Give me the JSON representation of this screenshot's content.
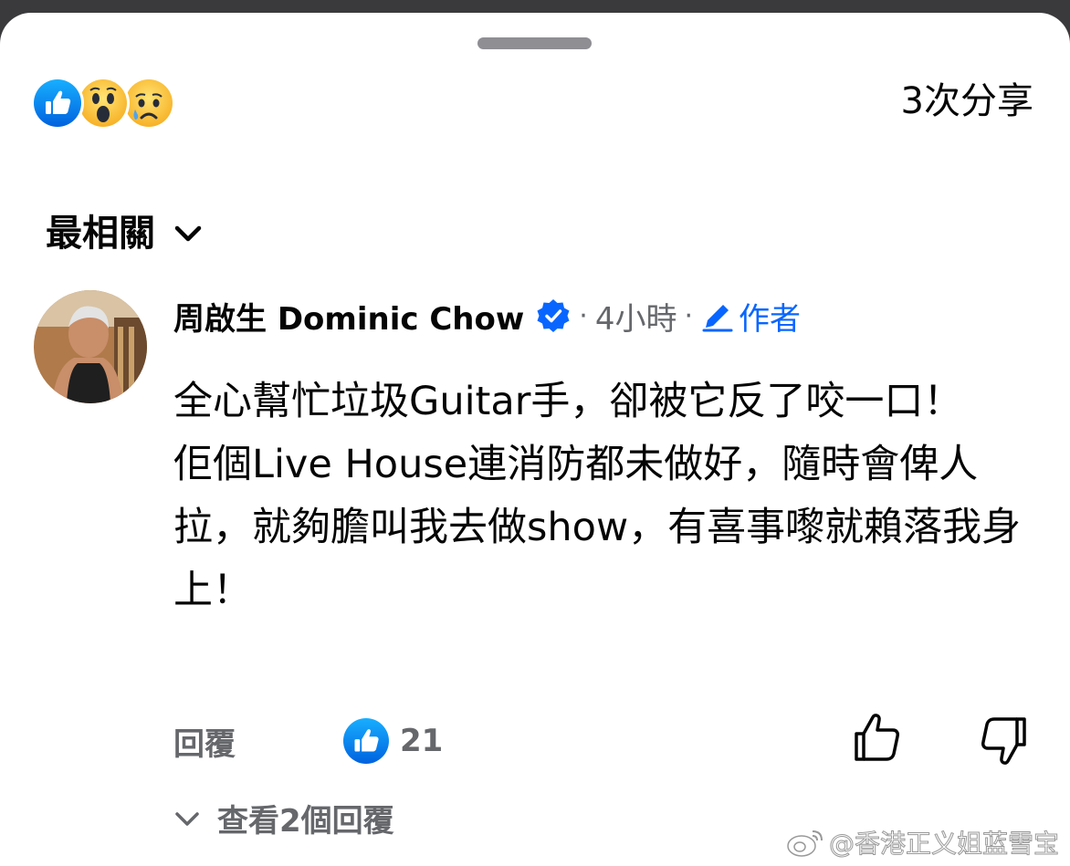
{
  "sheet": {
    "background": "#ffffff"
  },
  "reactions": {
    "icons": [
      "like-reaction-icon",
      "wow-reaction-icon",
      "sad-reaction-icon"
    ],
    "shares_label": "3次分享"
  },
  "sort": {
    "label": "最相關"
  },
  "comment": {
    "author": "周啟生 Dominic Chow",
    "dot1": "·",
    "time": "4小時",
    "dot2": "·",
    "badge": "作者",
    "text_lines": [
      "全心幫忙垃圾Guitar手，卻被它反了咬一口！",
      "佢個Live House連消防都未做好，隨時會俾人拉，就夠膽叫我去做show，有喜事嚟就賴落我身上！"
    ],
    "reply_label": "回覆",
    "like_count": "21",
    "view_replies": "查看2個回覆"
  },
  "watermark": {
    "text": "@香港正义姐蓝雪宝"
  },
  "colors": {
    "accent": "#0866ff",
    "muted": "#65676b",
    "text": "#050505",
    "like_blue": "#1877f2",
    "emoji_yellow": "#fcc83c"
  }
}
